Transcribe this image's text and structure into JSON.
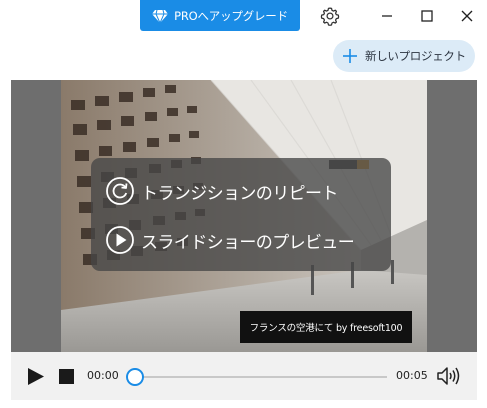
{
  "titlebar": {
    "pro_label": "PROへアップグレード"
  },
  "actions": {
    "new_project_label": "新しいプロジェクト"
  },
  "preview": {
    "menu": [
      {
        "label": "トランジションのリピート",
        "icon": "repeat-icon"
      },
      {
        "label": "スライドショーのプレビュー",
        "icon": "play-circle-icon"
      }
    ],
    "caption": "フランスの空港にて by freesoft100"
  },
  "player": {
    "current_time": "00:00",
    "total_time": "00:05",
    "progress": 0
  },
  "colors": {
    "accent": "#1a8ce6",
    "new_project_bg": "#dcebf7"
  }
}
